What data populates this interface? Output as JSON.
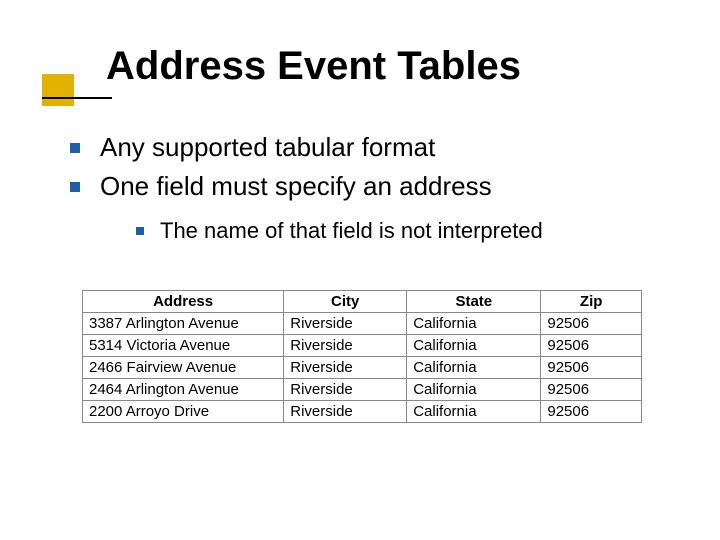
{
  "title": "Address Event Tables",
  "bullets": {
    "level1": [
      "Any supported tabular format",
      "One field must specify an address"
    ],
    "level2": [
      "The name of that field is not interpreted"
    ]
  },
  "table": {
    "headers": [
      "Address",
      "City",
      "State",
      "Zip"
    ],
    "rows": [
      [
        "3387 Arlington Avenue",
        "Riverside",
        "California",
        "92506"
      ],
      [
        "5314 Victoria Avenue",
        "Riverside",
        "California",
        "92506"
      ],
      [
        "2466 Fairview Avenue",
        "Riverside",
        "California",
        "92506"
      ],
      [
        "2464 Arlington Avenue",
        "Riverside",
        "California",
        "92506"
      ],
      [
        "2200 Arroyo Drive",
        "Riverside",
        "California",
        "92506"
      ]
    ]
  }
}
